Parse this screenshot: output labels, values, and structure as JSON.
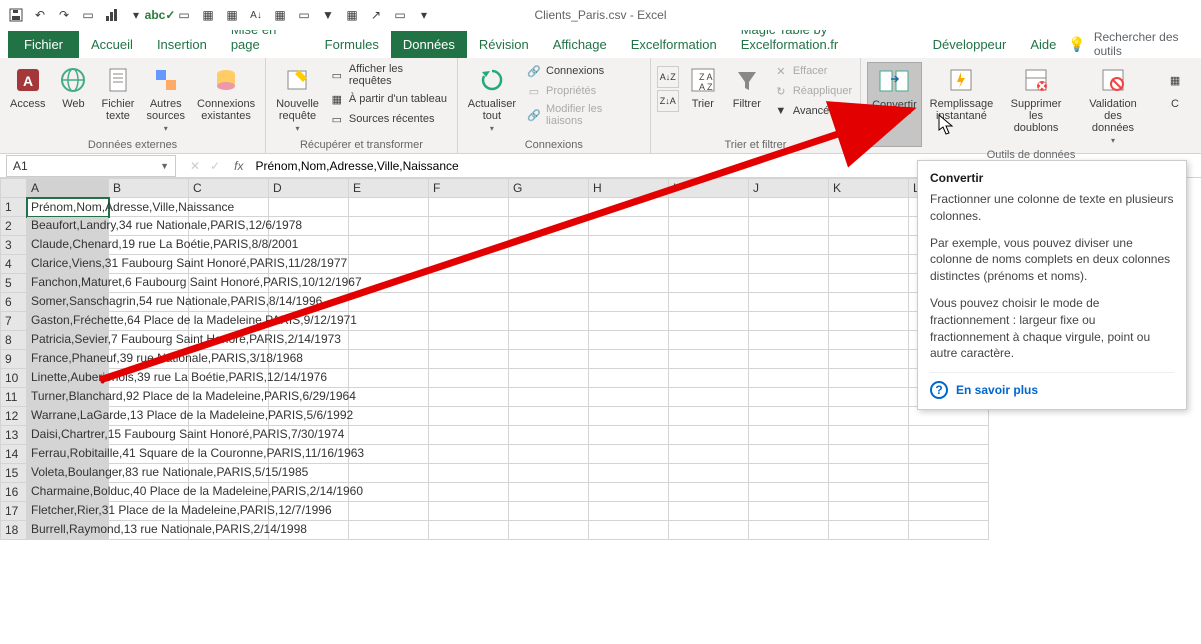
{
  "title": "Clients_Paris.csv  -  Excel",
  "tabs": {
    "file": "Fichier",
    "items": [
      "Accueil",
      "Insertion",
      "Mise en page",
      "Formules",
      "Données",
      "Révision",
      "Affichage",
      "Excelformation",
      "Magic Table by Excelformation.fr",
      "Développeur",
      "Aide"
    ],
    "active_index": 4,
    "tell_me": "Rechercher des outils"
  },
  "ribbon": {
    "group_ext": {
      "label": "Données externes",
      "access": "Access",
      "web": "Web",
      "fichier": "Fichier\ntexte",
      "autres": "Autres\nsources",
      "conn": "Connexions\nexistantes"
    },
    "group_transform": {
      "label": "Récupérer et transformer",
      "newquery": "Nouvelle\nrequête",
      "show_queries": "Afficher les requêtes",
      "from_table": "À partir d'un tableau",
      "recent": "Sources récentes"
    },
    "group_conn": {
      "label": "Connexions",
      "refresh": "Actualiser\ntout",
      "connections": "Connexions",
      "properties": "Propriétés",
      "edit_links": "Modifier les liaisons"
    },
    "group_sort": {
      "label": "Trier et filtrer",
      "sort": "Trier",
      "filter": "Filtrer",
      "clear": "Effacer",
      "reapply": "Réappliquer",
      "advanced": "Avancé"
    },
    "group_tools": {
      "label": "Outils de données",
      "convert": "Convertir",
      "flashfill": "Remplissage\ninstantané",
      "dedup": "Supprimer\nles doublons",
      "validation": "Validation des\ndonnées",
      "consolidate": "C"
    }
  },
  "namebox": "A1",
  "formula": "Prénom,Nom,Adresse,Ville,Naissance",
  "columns": [
    "A",
    "B",
    "C",
    "D",
    "E",
    "F",
    "G",
    "H",
    "I",
    "J",
    "K",
    "L"
  ],
  "rows": [
    "Prénom,Nom,Adresse,Ville,Naissance",
    "Beaufort,Landry,34 rue Nationale,PARIS,12/6/1978",
    "Claude,Chenard,19 rue La Boétie,PARIS,8/8/2001",
    "Clarice,Viens,31 Faubourg Saint Honoré,PARIS,11/28/1977",
    "Fanchon,Maturet,6 Faubourg Saint Honoré,PARIS,10/12/1967",
    "Somer,Sanschagrin,54 rue Nationale,PARIS,8/14/1996",
    "Gaston,Fréchette,64 Place de la Madeleine,PARIS,9/12/1971",
    "Patricia,Sevier,7 Faubourg Saint Honoré,PARIS,2/14/1973",
    "France,Phaneuf,39 rue Nationale,PARIS,3/18/1968",
    "Linette,Auberjonois,39 rue La Boétie,PARIS,12/14/1976",
    "Turner,Blanchard,92 Place de la Madeleine,PARIS,6/29/1964",
    "Warrane,LaGarde,13 Place de la Madeleine,PARIS,5/6/1992",
    "Daisi,Chartrer,15 Faubourg Saint Honoré,PARIS,7/30/1974",
    "Ferrau,Robitaille,41 Square de la Couronne,PARIS,11/16/1963",
    "Voleta,Boulanger,83 rue Nationale,PARIS,5/15/1985",
    "Charmaine,Bolduc,40 Place de la Madeleine,PARIS,2/14/1960",
    "Fletcher,Rier,31 Place de la Madeleine,PARIS,12/7/1996",
    "Burrell,Raymond,13 rue Nationale,PARIS,2/14/1998"
  ],
  "tooltip": {
    "title": "Convertir",
    "p1": "Fractionner une colonne de texte en plusieurs colonnes.",
    "p2": "Par exemple, vous pouvez diviser une colonne de noms complets en deux colonnes distinctes (prénoms et noms).",
    "p3": "Vous pouvez choisir le mode de fractionnement : largeur fixe ou fractionnement à chaque virgule, point ou autre caractère.",
    "learn": "En savoir plus"
  }
}
